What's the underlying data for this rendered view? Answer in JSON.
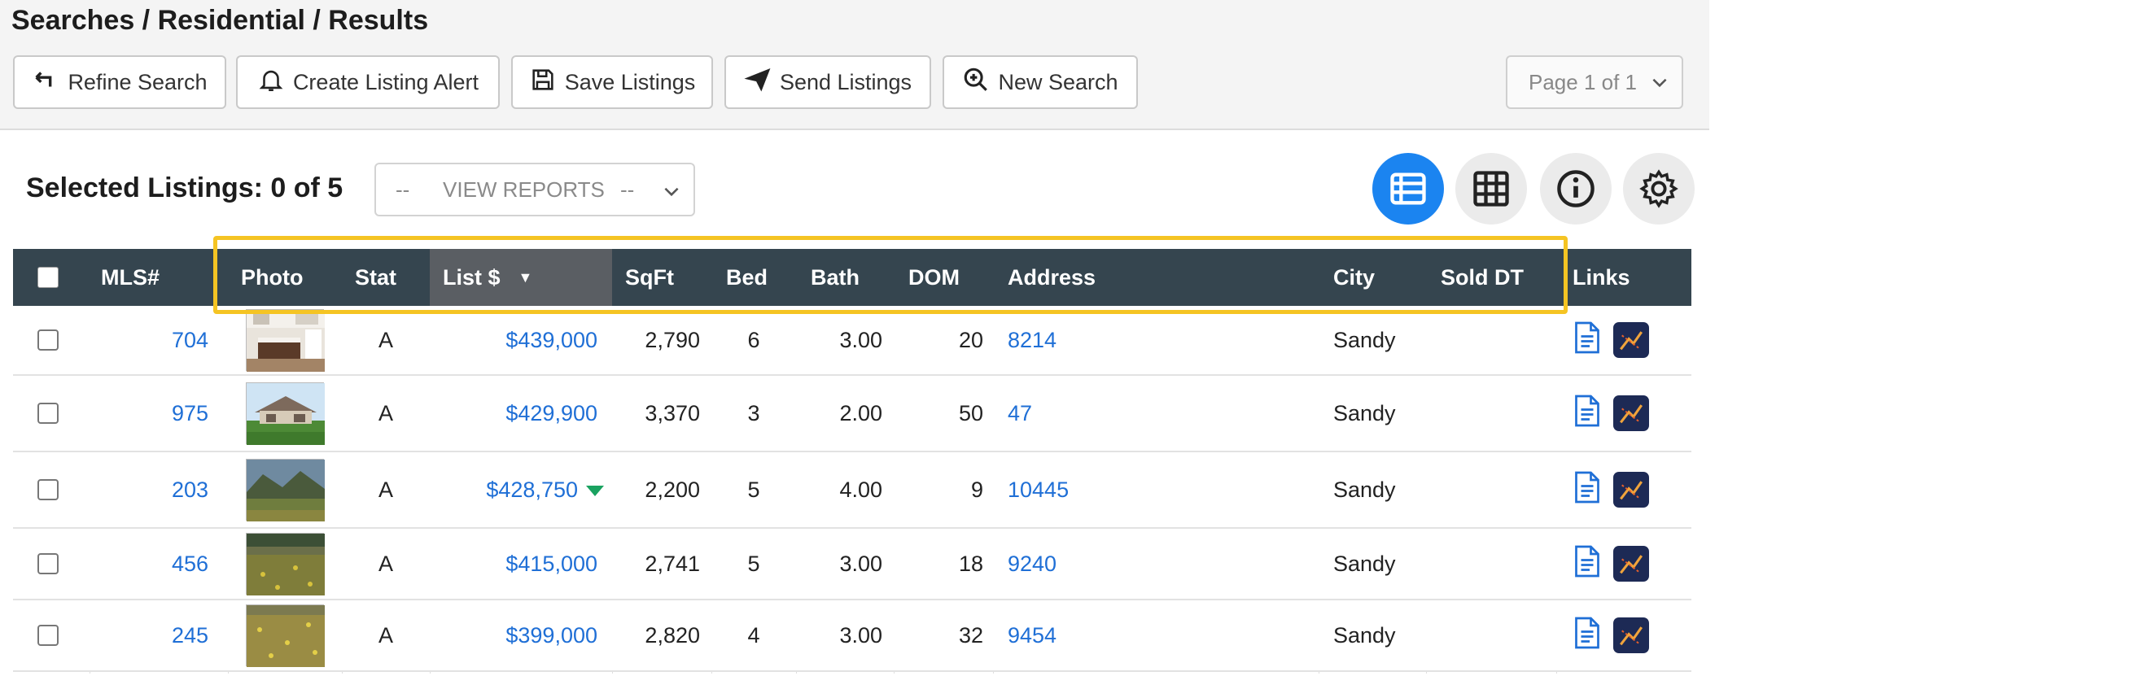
{
  "breadcrumb": "Searches / Residential / Results",
  "toolbar": {
    "refine": "Refine Search",
    "alert": "Create Listing Alert",
    "save": "Save Listings",
    "send": "Send Listings",
    "new": "New Search",
    "page": "Page 1 of 1"
  },
  "selection": {
    "label": "Selected Listings: 0 of 5",
    "reports_left": "--",
    "reports_label": "VIEW REPORTS",
    "reports_right": "--"
  },
  "view_icons": [
    "list-view-icon",
    "grid-view-icon",
    "info-icon",
    "gear-icon"
  ],
  "colors": {
    "header": "#35454f",
    "accent": "#1b84f0",
    "link": "#1f6fd6",
    "highlight": "#f5c423",
    "price_down": "#1aa260"
  },
  "columns": [
    "MLS#",
    "Photo",
    "Stat",
    "List $",
    "SqFt",
    "Bed",
    "Bath",
    "DOM",
    "Address",
    "City",
    "Sold DT",
    "Links"
  ],
  "sort": {
    "column": "List $",
    "direction": "descending",
    "arrow": "▼"
  },
  "rows": [
    {
      "mls": "704",
      "stat": "A",
      "price": "$439,000",
      "sqft": "2,790",
      "bed": "6",
      "bath": "3.00",
      "dom": "20",
      "address": "8214",
      "city": "Sandy",
      "sold": "",
      "photo": "kitchen",
      "price_drop": false
    },
    {
      "mls": "975",
      "stat": "A",
      "price": "$429,900",
      "sqft": "3,370",
      "bed": "3",
      "bath": "2.00",
      "dom": "50",
      "address": "47",
      "city": "Sandy",
      "sold": "",
      "photo": "house",
      "price_drop": false
    },
    {
      "mls": "203",
      "stat": "A",
      "price": "$428,750",
      "sqft": "2,200",
      "bed": "5",
      "bath": "4.00",
      "dom": "9",
      "address": "10445",
      "city": "Sandy",
      "sold": "",
      "photo": "mountain",
      "price_drop": true
    },
    {
      "mls": "456",
      "stat": "A",
      "price": "$415,000",
      "sqft": "2,741",
      "bed": "5",
      "bath": "3.00",
      "dom": "18",
      "address": "9240",
      "city": "Sandy",
      "sold": "",
      "photo": "field",
      "price_drop": false
    },
    {
      "mls": "245",
      "stat": "A",
      "price": "$399,000",
      "sqft": "2,820",
      "bed": "4",
      "bath": "3.00",
      "dom": "32",
      "address": "9454",
      "city": "Sandy",
      "sold": "",
      "photo": "meadow",
      "price_drop": false
    }
  ]
}
